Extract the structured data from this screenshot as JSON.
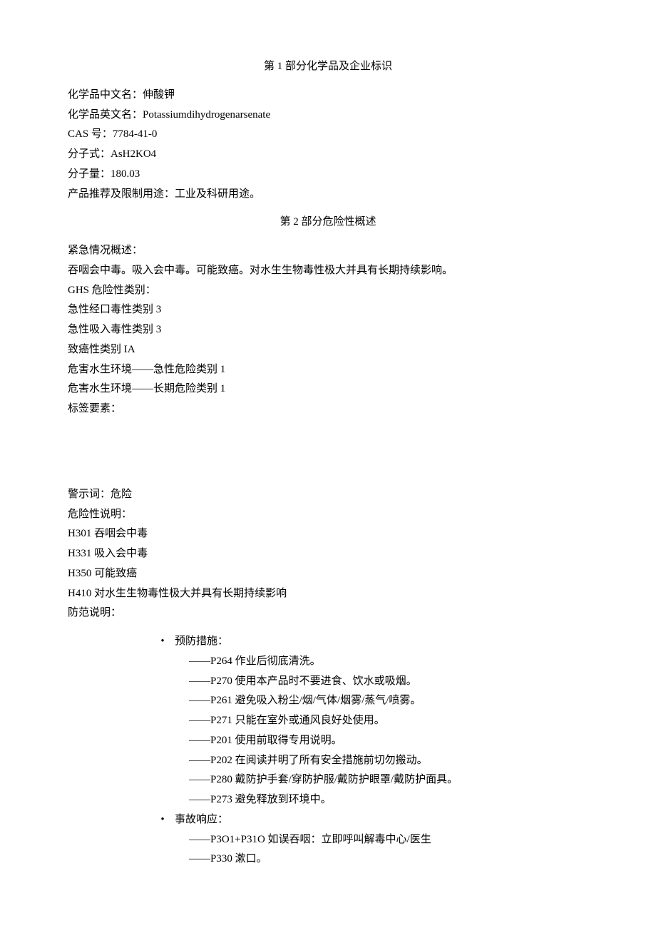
{
  "section1": {
    "title": "第 1 部分化学品及企业标识",
    "fields": [
      "化学品中文名：伸酸钾",
      "化学品英文名：Potassiumdihydrogenarsenate",
      "CAS 号：7784-41-0",
      "分子式：AsH2KO4",
      "分子量：180.03",
      "产品推荐及限制用途：工业及科研用途。"
    ]
  },
  "section2": {
    "title": "第 2 部分危险性概述",
    "block1": [
      "紧急情况概述：",
      "吞咽会中毒。吸入会中毒。可能致癌。对水生生物毒性极大并具有长期持续影响。",
      "GHS 危险性类别：",
      "急性经口毒性类别 3",
      "急性吸入毒性类别 3",
      "致癌性类别 IA",
      "危害水生环境——急性危险类别 1",
      "危害水生环境——长期危险类别 1",
      "标签要素："
    ],
    "block2": [
      "警示词：危险",
      "危险性说明：",
      "H301 吞咽会中毒",
      "H331 吸入会中毒",
      "H350 可能致癌",
      "H410 对水生生物毒性极大并具有长期持续影响",
      "防范说明："
    ],
    "precautions": {
      "header": "预防措施：",
      "items": [
        "——P264 作业后彻底清洗。",
        "——P270 使用本产品时不要进食、饮水或吸烟。",
        "——P261 避免吸入粉尘/烟/气体/烟雾/蒸气/喷雾。",
        "——P271 只能在室外或通风良好处使用。",
        "——P201 使用前取得专用说明。",
        "——P202 在阅读并明了所有安全措施前切勿搬动。",
        "——P280 戴防护手套/穿防护服/戴防护眼罩/戴防护面具。",
        "——P273 避免释放到环境中。"
      ]
    },
    "response": {
      "header": "事故响应：",
      "items": [
        "——P3O1+P31O 如误吞咽：立即呼叫解毒中心/医生",
        "——P330 漱口。"
      ]
    }
  }
}
